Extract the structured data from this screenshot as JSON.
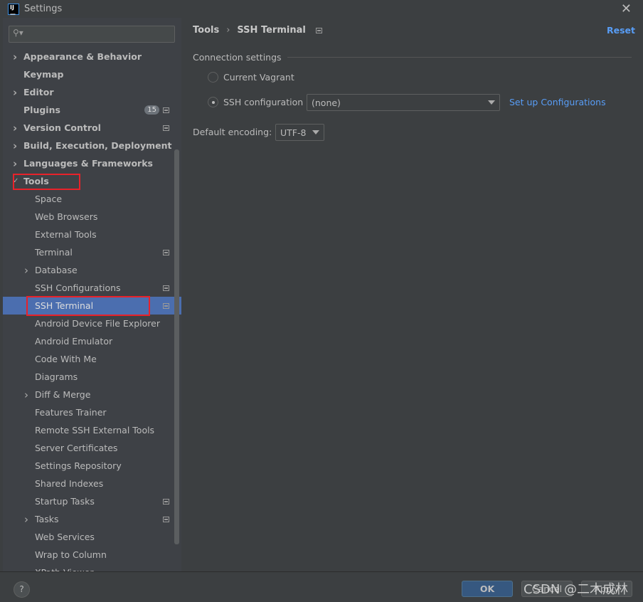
{
  "window": {
    "title": "Settings",
    "logo": "IJ"
  },
  "sidebar": {
    "search_placeholder": "",
    "items": [
      {
        "label": "Appearance & Behavior",
        "level": 0,
        "bold": true,
        "expandable": true
      },
      {
        "label": "Keymap",
        "level": 0,
        "bold": true
      },
      {
        "label": "Editor",
        "level": 0,
        "bold": true,
        "expandable": true
      },
      {
        "label": "Plugins",
        "level": 0,
        "bold": true,
        "badge": "15",
        "pinned": true
      },
      {
        "label": "Version Control",
        "level": 0,
        "bold": true,
        "expandable": true,
        "pinned": true
      },
      {
        "label": "Build, Execution, Deployment",
        "level": 0,
        "bold": true,
        "expandable": true
      },
      {
        "label": "Languages & Frameworks",
        "level": 0,
        "bold": true,
        "expandable": true
      },
      {
        "label": "Tools",
        "level": 0,
        "bold": true,
        "expanded": true,
        "highlighted": true
      },
      {
        "label": "Space",
        "level": 1
      },
      {
        "label": "Web Browsers",
        "level": 1
      },
      {
        "label": "External Tools",
        "level": 1
      },
      {
        "label": "Terminal",
        "level": 1,
        "pinned": true
      },
      {
        "label": "Database",
        "level": 1,
        "expandable": true
      },
      {
        "label": "SSH Configurations",
        "level": 1,
        "pinned": true
      },
      {
        "label": "SSH Terminal",
        "level": 1,
        "pinned": true,
        "selected": true,
        "highlighted": true
      },
      {
        "label": "Android Device File Explorer",
        "level": 1
      },
      {
        "label": "Android Emulator",
        "level": 1
      },
      {
        "label": "Code With Me",
        "level": 1
      },
      {
        "label": "Diagrams",
        "level": 1
      },
      {
        "label": "Diff & Merge",
        "level": 1,
        "expandable": true
      },
      {
        "label": "Features Trainer",
        "level": 1
      },
      {
        "label": "Remote SSH External Tools",
        "level": 1
      },
      {
        "label": "Server Certificates",
        "level": 1
      },
      {
        "label": "Settings Repository",
        "level": 1
      },
      {
        "label": "Shared Indexes",
        "level": 1
      },
      {
        "label": "Startup Tasks",
        "level": 1,
        "pinned": true
      },
      {
        "label": "Tasks",
        "level": 1,
        "expandable": true,
        "pinned": true
      },
      {
        "label": "Web Services",
        "level": 1
      },
      {
        "label": "Wrap to Column",
        "level": 1
      },
      {
        "label": "XPath Viewer",
        "level": 1
      }
    ]
  },
  "main": {
    "breadcrumb": [
      "Tools",
      "SSH Terminal"
    ],
    "reset": "Reset",
    "group_title": "Connection settings",
    "radio_vagrant": "Current Vagrant",
    "radio_ssh": "SSH configuration",
    "selected_radio": "SSH configuration",
    "ssh_config_value": "(none)",
    "setup_link": "Set up Configurations",
    "encoding_label": "Default encoding:",
    "encoding_value": "UTF-8"
  },
  "footer": {
    "help": "?",
    "ok": "OK",
    "cancel": "Cancel",
    "apply": "Apply",
    "watermark": "CSDN @二木成林"
  },
  "colors": {
    "accent": "#4b6eaf",
    "link": "#589df6",
    "highlight_box": "#e8222a"
  }
}
